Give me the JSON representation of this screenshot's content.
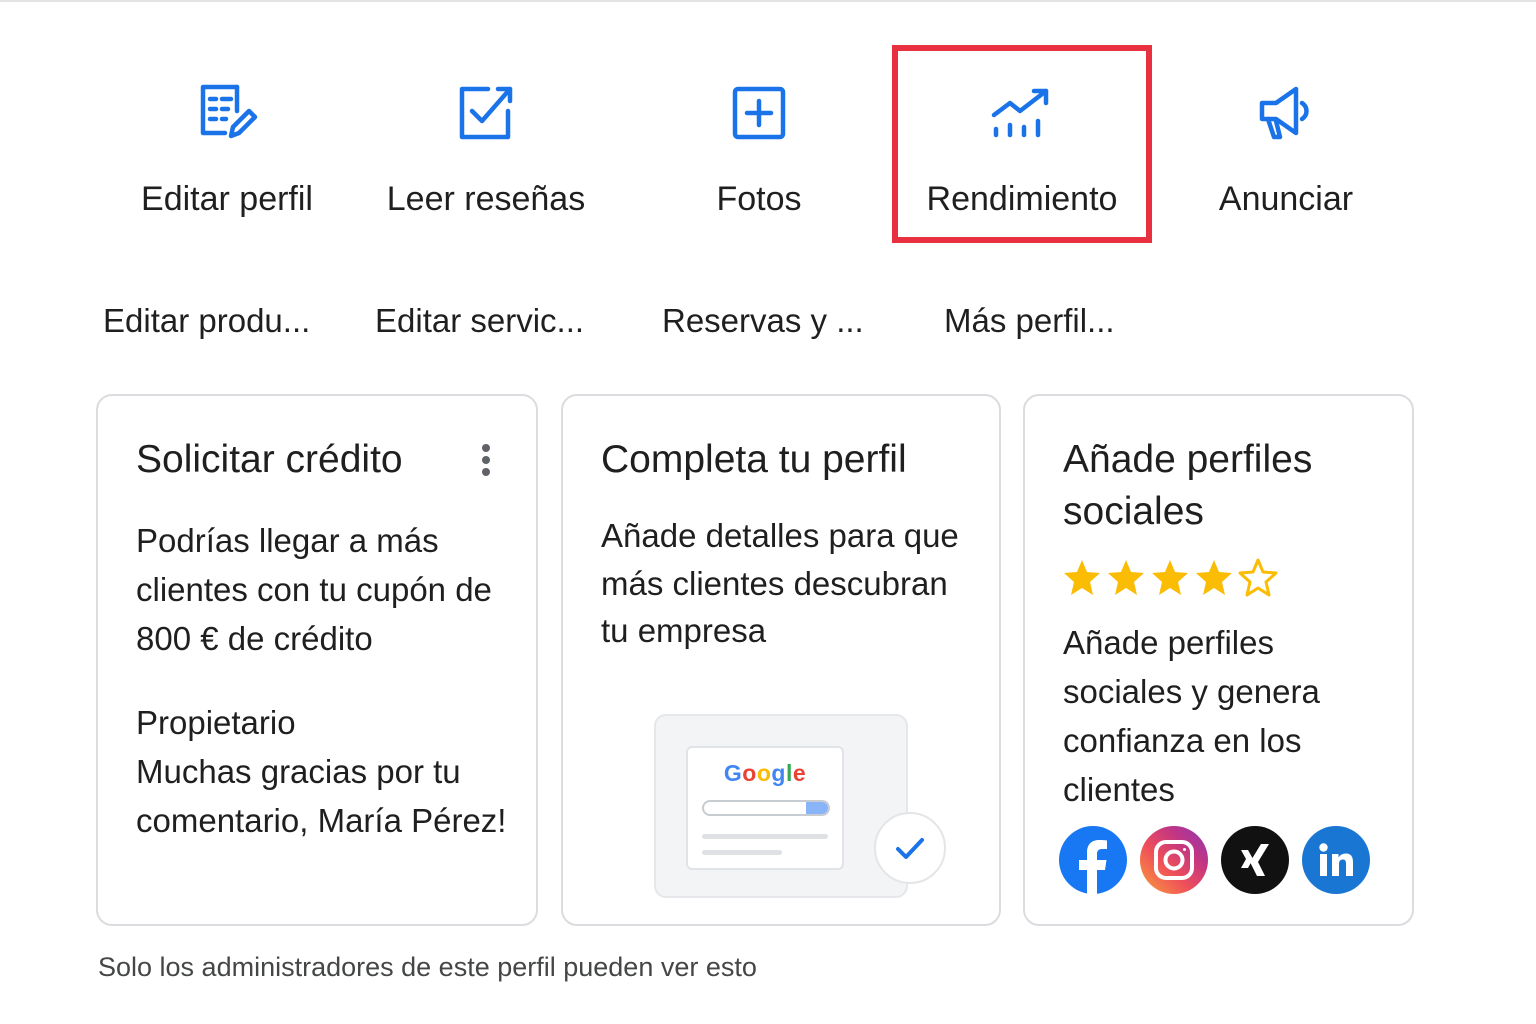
{
  "actions": [
    {
      "label": "Editar perfil",
      "icon": "edit-profile-icon"
    },
    {
      "label": "Leer reseñas",
      "icon": "reviews-icon"
    },
    {
      "label": "Fotos",
      "icon": "add-photo-icon"
    },
    {
      "label": "Rendimiento",
      "icon": "performance-chart-icon"
    },
    {
      "label": "Anunciar",
      "icon": "megaphone-icon"
    }
  ],
  "chips": [
    "Editar produ...",
    "Editar servic...",
    "Reservas y ...",
    "Más perfil..."
  ],
  "cards": {
    "credit": {
      "title": "Solicitar crédito",
      "body": "Podrías llegar a más clientes con tu cupón de 800 € de crédito",
      "owner_label": "Propietario",
      "reply": "Muchas gracias por tu comentario, María Pérez!"
    },
    "complete": {
      "title": "Completa tu perfil",
      "body": "Añade detalles para que más clientes descubran tu empresa",
      "logo_text": "Google"
    },
    "social": {
      "title": "Añade perfiles sociales",
      "rating": 4.5,
      "body": "Añade perfiles sociales y genera confianza en los clientes",
      "networks": [
        "facebook-icon",
        "instagram-icon",
        "xing-icon",
        "linkedin-icon"
      ]
    }
  },
  "footer_note": "Solo los administradores de este perfil pueden ver esto",
  "colors": {
    "accent": "#1a73e8",
    "highlight": "#e8303f",
    "star": "#fbbc04",
    "border": "#dadce0"
  }
}
